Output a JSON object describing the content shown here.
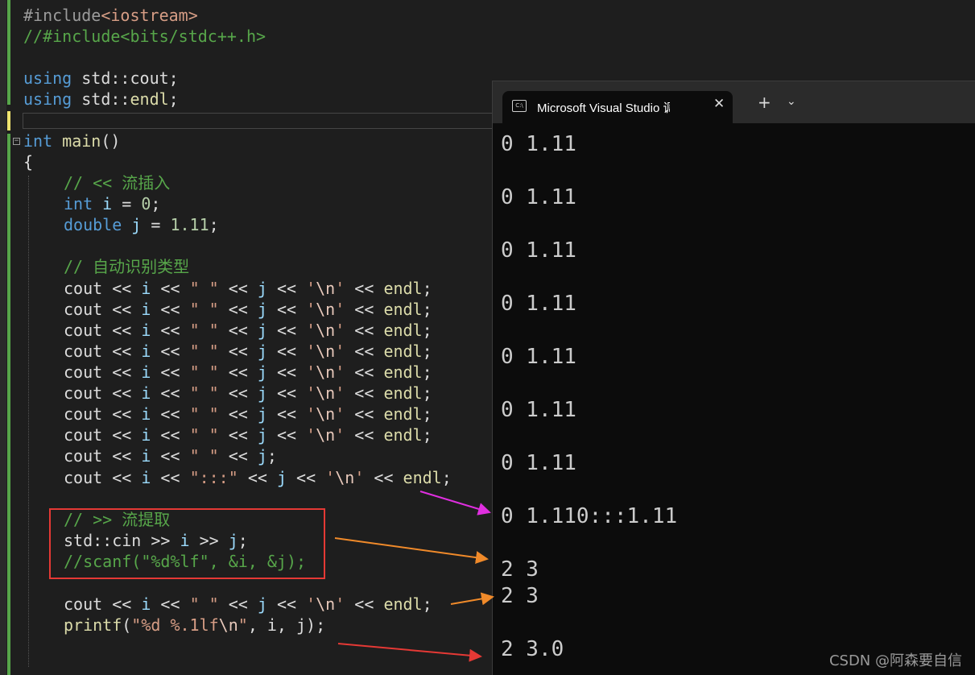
{
  "code": {
    "include_directive": "#include",
    "include_header": "<iostream>",
    "commented_include": "//#include<bits/stdc++.h>",
    "using_kw": "using",
    "using_ns": "std::",
    "using_cout": "cout",
    "using_endl": "endl",
    "semicolon": ";",
    "int_kw": "int",
    "main_fn": "main",
    "parens": "()",
    "open_brace": "{",
    "comment_insert": "// << 流插入",
    "decl_int_kw": "int",
    "decl_i": "i",
    "decl_i_init": " = ",
    "decl_i_val": "0",
    "decl_double_kw": "double",
    "decl_j": "j",
    "decl_j_val": "1.11",
    "comment_auto": "// 自动识别类型",
    "cout_line_count": 8,
    "cout_kw": "cout",
    "op_ins": " << ",
    "var_i": "i",
    "var_j": "j",
    "space_str": "\" \"",
    "nl_open": "'",
    "nl_esc": "\\n",
    "nl_close": "'",
    "endl_kw": "endl",
    "colons_str": "\":::\"",
    "comment_extract": "// >> 流提取",
    "cin_prefix": "std::",
    "cin_kw": "cin",
    "op_ext": " >> ",
    "scanf_comment": "//scanf(\"%d%lf\", &i, &j);",
    "printf_fn": "printf",
    "printf_fmt_a": "\"%d %.1lf",
    "printf_fmt_esc": "\\n",
    "printf_fmt_b": "\"",
    "printf_args": ", i, j);"
  },
  "console": {
    "tab_icon": "C:\\",
    "tab_title": "Microsoft Visual Studio 调试控制台",
    "close_glyph": "✕",
    "new_tab_glyph": "+",
    "menu_glyph": "⌄",
    "output_lines": [
      "0 1.11",
      "0 1.11",
      "0 1.11",
      "0 1.11",
      "0 1.11",
      "0 1.11",
      "0 1.11",
      "0 1.110:::1.11",
      "2 3",
      "2 3",
      "2 3.0"
    ]
  },
  "annotations": {
    "arrow_colors": [
      "#e02fe0",
      "#f08a2a",
      "#f08a2a",
      "#e53935"
    ],
    "box_color": "#e53935"
  },
  "watermark": "CSDN @阿森要自信"
}
